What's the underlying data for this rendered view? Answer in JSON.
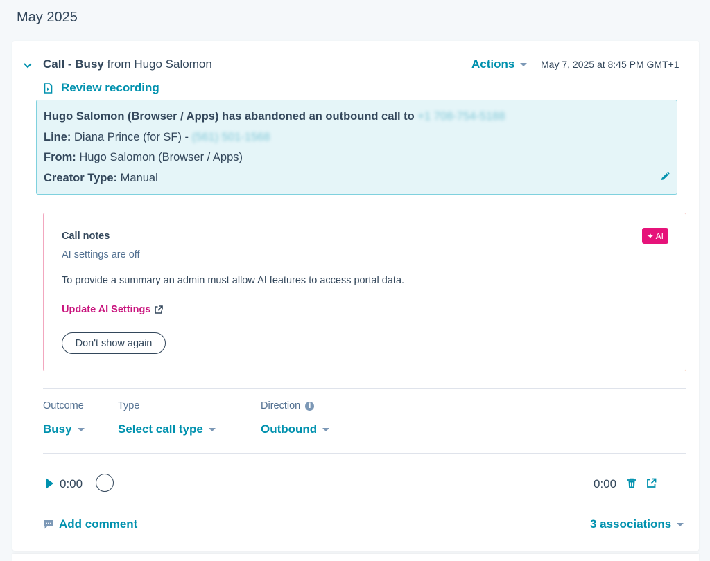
{
  "month_heading": "May 2025",
  "activity": {
    "type_label": "Call - Busy",
    "from_text": "from Hugo Salomon",
    "actions_label": "Actions",
    "timestamp": "May 7, 2025 at 8:45 PM GMT+1",
    "review_recording_label": "Review recording"
  },
  "details": {
    "headline": "Hugo Salomon (Browser / Apps) has abandoned an outbound call to",
    "headline_phone": "+1 708-754-5188",
    "line_label": "Line:",
    "line_value": "Diana Prince (for SF) -",
    "line_phone": "(561) 501-1568",
    "from_label": "From:",
    "from_value": "Hugo Salomon (Browser / Apps)",
    "creator_label": "Creator Type:",
    "creator_value": "Manual"
  },
  "call_notes": {
    "title": "Call notes",
    "ai_badge": "✦ AI",
    "status": "AI settings are off",
    "description": "To provide a summary an admin must allow AI features to access portal data.",
    "update_link": "Update AI Settings",
    "dismiss_button": "Don't show again"
  },
  "properties": {
    "outcome_label": "Outcome",
    "outcome_value": "Busy",
    "type_label": "Type",
    "type_value": "Select call type",
    "direction_label": "Direction",
    "direction_value": "Outbound"
  },
  "player": {
    "current_time": "0:00",
    "duration": "0:00"
  },
  "footer": {
    "add_comment": "Add comment",
    "associations": "3 associations"
  },
  "colors": {
    "accent": "#0091ae",
    "ai_pink": "#e6137a",
    "info_bg": "#e5f5f8"
  }
}
